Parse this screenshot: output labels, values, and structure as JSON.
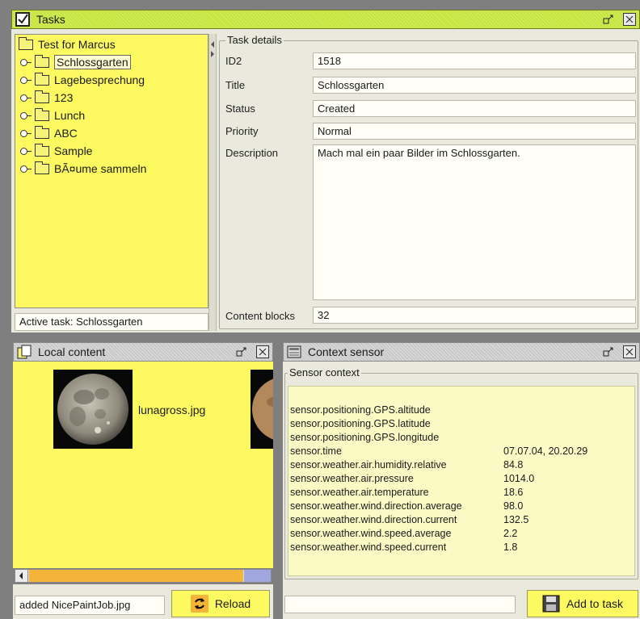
{
  "tasks_window": {
    "title": "Tasks",
    "tree": {
      "root": "Test for Marcus",
      "items": [
        "Schlossgarten",
        "Lagebesprechung",
        "123",
        "Lunch",
        "ABC",
        "Sample",
        "BÃ¤ume sammeln"
      ]
    },
    "active_task": "Active task: Schlossgarten",
    "details": {
      "group_title": "Task details",
      "id_label": "ID2",
      "id_value": "1518",
      "title_label": "Title",
      "title_value": "Schlossgarten",
      "status_label": "Status",
      "status_value": "Created",
      "priority_label": "Priority",
      "priority_value": "Normal",
      "description_label": "Description",
      "description_value": "Mach mal ein paar Bilder im Schlossgarten.",
      "content_blocks_label": "Content blocks",
      "content_blocks_value": "32"
    }
  },
  "local_content": {
    "title": "Local content",
    "items": [
      {
        "filename": "lunagross.jpg"
      }
    ],
    "status_field": "added NicePaintJob.jpg",
    "reload_label": "Reload"
  },
  "context_sensor": {
    "title": "Context sensor",
    "group_title": "Sensor context",
    "rows": [
      {
        "key": "sensor.positioning.GPS.altitude",
        "value": ""
      },
      {
        "key": "sensor.positioning.GPS.latitude",
        "value": ""
      },
      {
        "key": "sensor.positioning.GPS.longitude",
        "value": ""
      },
      {
        "key": "sensor.time",
        "value": "07.07.04, 20.20.29"
      },
      {
        "key": "sensor.weather.air.humidity.relative",
        "value": "84.8"
      },
      {
        "key": "sensor.weather.air.pressure",
        "value": "1014.0"
      },
      {
        "key": "sensor.weather.air.temperature",
        "value": "18.6"
      },
      {
        "key": "sensor.weather.wind.direction.average",
        "value": "98.0"
      },
      {
        "key": "sensor.weather.wind.direction.current",
        "value": "132.5"
      },
      {
        "key": "sensor.weather.wind.speed.average",
        "value": "2.2"
      },
      {
        "key": "sensor.weather.wind.speed.current",
        "value": "1.8"
      }
    ],
    "input_value": "",
    "add_label": "Add to task"
  },
  "icons": {
    "window": "checkbox-document-icon",
    "maximize": "maximize-arrow-icon",
    "close": "close-box-icon",
    "folder": "folder-icon",
    "expand": "tree-expand-handle-icon",
    "reload": "circular-arrows-icon",
    "add": "floppy-disk-icon"
  },
  "colors": {
    "title_green": "#c6e43a",
    "panel_yellow": "#fdfa61",
    "panel_beige": "#e9e9dd",
    "scroll_orange": "#f4b43a"
  }
}
